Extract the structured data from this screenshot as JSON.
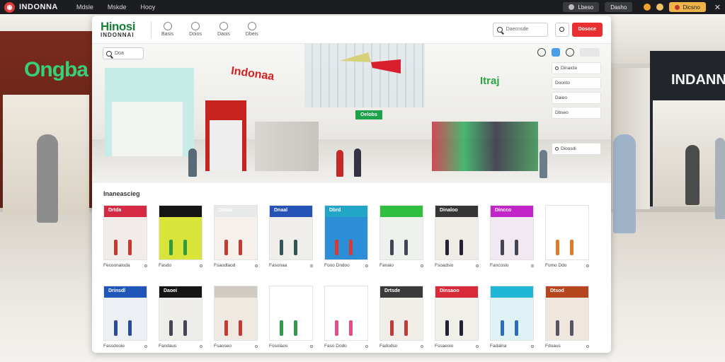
{
  "topbar": {
    "app_name": "INDONNA",
    "menu": [
      "Mdsle",
      "Mskde",
      "Hooy"
    ],
    "pill_left": "Lbeso",
    "pill_mid": "Dasho",
    "pill_right": "Dicsno"
  },
  "window": {
    "brand": "Hinosi",
    "brand_sub": "INDONNAI",
    "nav": [
      "Basis",
      "Doios",
      "Daois",
      "Dbeis"
    ],
    "search_placeholder": "Daecnsde",
    "cta_label": "Dosoce"
  },
  "hero": {
    "search_text": "Doa",
    "sign_red": "Indonaa",
    "sign_green": "Itraj",
    "banner": "Oelobs",
    "side_items": [
      "Dinaicle",
      "Doonto",
      "Daieo",
      "Dbseo",
      "Dioosdi"
    ]
  },
  "products": {
    "title": "Inaneascieg",
    "items": [
      {
        "label": "Fecoonaloda",
        "sign": "Drtda",
        "color": "#d52a43",
        "bg": "#f1ecea",
        "fig": "#c9372e"
      },
      {
        "label": "Fasdo",
        "sign": "",
        "color": "#151515",
        "bg": "#d9e43a",
        "fig": "#2f9b3f"
      },
      {
        "label": "Fsaodlaod",
        "sign": "Dmos",
        "color": "#e8eaea",
        "bg": "#f5f0ea",
        "fig": "#c43a36"
      },
      {
        "label": "Fasonaa",
        "sign": "Dnaal",
        "color": "#2553b8",
        "bg": "#f0eeea",
        "fig": "#355"
      },
      {
        "label": "Fooo Dndoo",
        "sign": "Dbrd",
        "color": "#21a6c8",
        "bg": "#2c8ed6",
        "fig": "#d63a33"
      },
      {
        "label": "Fanaio",
        "sign": "",
        "color": "#2fbe3d",
        "bg": "#eef2ec",
        "fig": "#445"
      },
      {
        "label": "Fsoadsio",
        "sign": "Dinaloo",
        "color": "#353535",
        "bg": "#efebe6",
        "fig": "#223"
      },
      {
        "label": "Fancoslo",
        "sign": "Dincco",
        "color": "#c124c8",
        "bg": "#f2e8f2",
        "fig": "#445"
      },
      {
        "label": "Fomo Ddo",
        "sign": "",
        "color": "#ffffff",
        "bg": "#ffffff",
        "fig": "#e07a2a"
      },
      {
        "label": "Fassdooie",
        "sign": "Drinsdl",
        "color": "#1f56b8",
        "bg": "#ecf0f4",
        "fig": "#2a4aa0"
      },
      {
        "label": "Fandaus",
        "sign": "Daoei",
        "color": "#151515",
        "bg": "#efedea",
        "fig": "#445"
      },
      {
        "label": "Fsaoseo",
        "sign": "",
        "color": "#cfcac2",
        "bg": "#efe9e2",
        "fig": "#c43a36"
      },
      {
        "label": "Fosolaos",
        "sign": "",
        "color": "#ffffff",
        "bg": "#ffffff",
        "fig": "#2e9c4a"
      },
      {
        "label": "Faso Dodo",
        "sign": "",
        "color": "#ffffff",
        "bg": "#ffffff",
        "fig": "#e84a8a"
      },
      {
        "label": "Fadodso",
        "sign": "Drtsde",
        "color": "#3a3a3a",
        "bg": "#f1ede8",
        "fig": "#c43a36"
      },
      {
        "label": "Fssaeoio",
        "sign": "Dinsaoo",
        "color": "#d92a3a",
        "bg": "#f1efea",
        "fig": "#223"
      },
      {
        "label": "Fadalna",
        "sign": "",
        "color": "#20b6d8",
        "bg": "#dff3f7",
        "fig": "#2b6cc2"
      },
      {
        "label": "Fdoaus",
        "sign": "Dtsod",
        "color": "#b5461e",
        "bg": "#efe7de",
        "fig": "#556"
      }
    ]
  }
}
